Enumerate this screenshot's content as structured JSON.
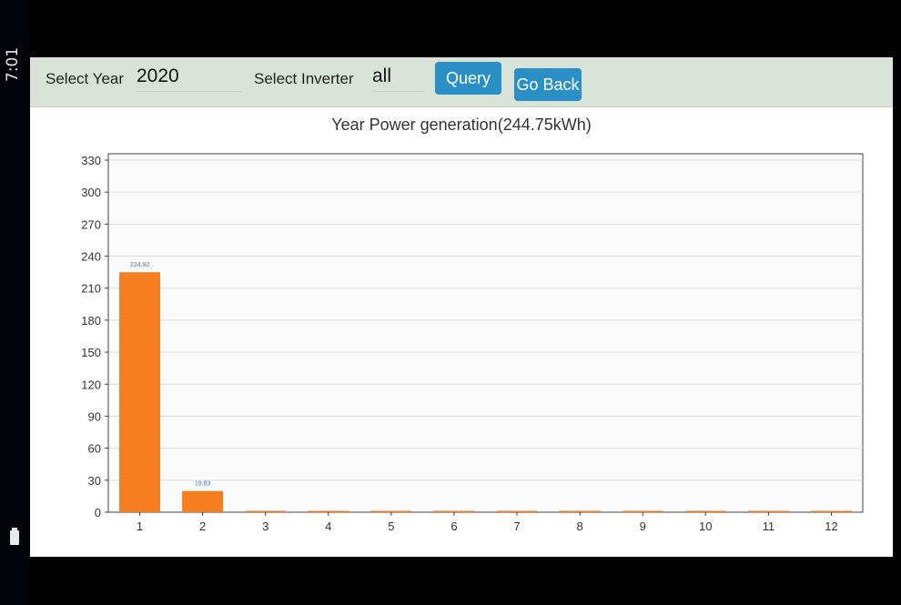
{
  "status": {
    "time": "7:01"
  },
  "toolbar": {
    "year_label": "Select Year",
    "year_value": "2020",
    "inverter_label": "Select Inverter",
    "inverter_value": "all",
    "query_label": "Query",
    "back_label": "Go Back"
  },
  "chart_data": {
    "type": "bar",
    "title": "Year Power generation(244.75kWh)",
    "categories": [
      "1",
      "2",
      "3",
      "4",
      "5",
      "6",
      "7",
      "8",
      "9",
      "10",
      "11",
      "12"
    ],
    "values": [
      224.92,
      19.83,
      0,
      0,
      0,
      0,
      0,
      0,
      0,
      0,
      0,
      0
    ],
    "data_labels": [
      "224.92",
      "19.83",
      "",
      "",
      "",
      "",
      "",
      "",
      "",
      "",
      "",
      ""
    ],
    "ylim": [
      0,
      330
    ],
    "yticks": [
      "0",
      "30",
      "60",
      "90",
      "120",
      "150",
      "180",
      "210",
      "240",
      "270",
      "300",
      "330"
    ],
    "grid": true,
    "bar_color": "#f57f20",
    "label_color": "#4a7ab0"
  }
}
